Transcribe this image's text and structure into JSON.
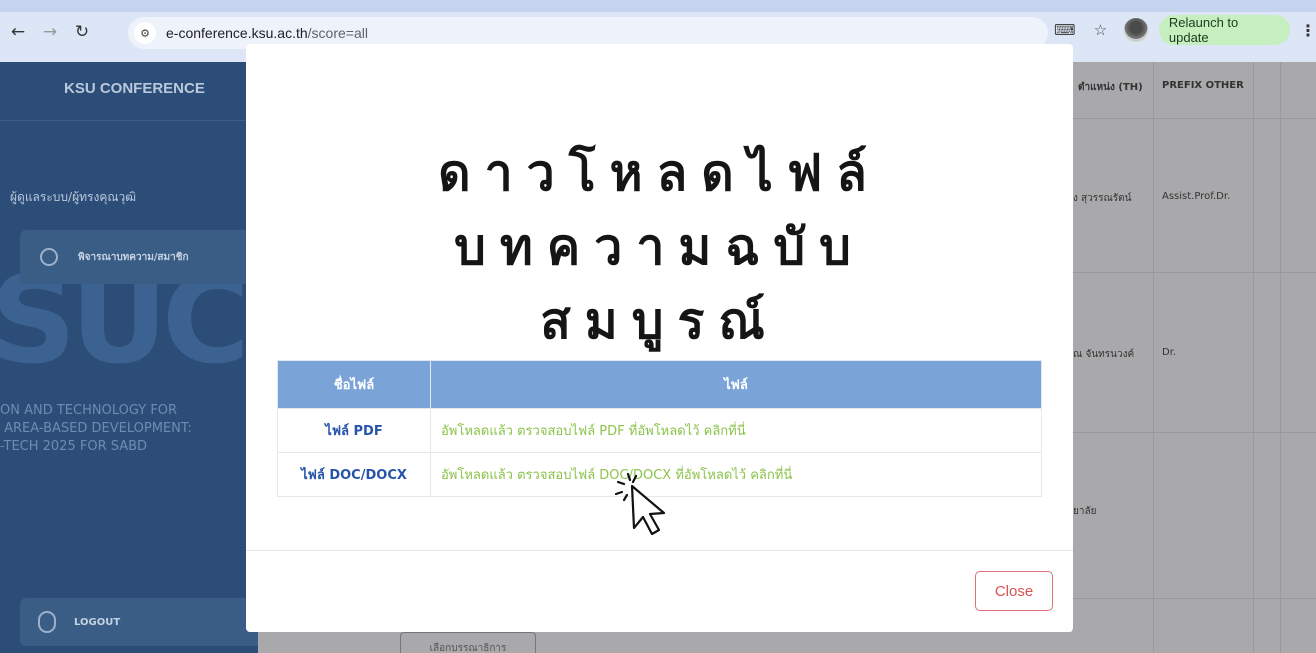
{
  "browser": {
    "url_domain": "e-conference.ksu.ac.th",
    "url_path": "/score=all",
    "relaunch_label": "Relaunch to update"
  },
  "sidebar": {
    "brand": "KSU CONFERENCE",
    "section": "ผู้ดูแลระบบ/ผู้ทรงคุณวุฒิ",
    "item_label": "พิจารณาบทความ/สมาชิก",
    "watermark": "SUC",
    "partial_text": "ON AND TECHNOLOGY FOR\n AREA-BASED DEVELOPMENT:\n-TECH 2025 FOR SABD",
    "logout_label": "LOGOUT"
  },
  "background_table": {
    "header_a": "ตำแหน่ง (TH)",
    "header_b": "PREFIX OTHER",
    "rows": [
      {
        "a": "ง สุวรรณรัตน์",
        "b": "Assist.Prof.Dr."
      },
      {
        "a": "ณ จันทรนวงค์",
        "b": "Dr."
      },
      {
        "a": "ยาลัย",
        "b": ""
      }
    ],
    "bottom_button": "เลือกบรรณาธิการ"
  },
  "modal": {
    "title_lines": [
      "ดาวโหลดไฟล์",
      "บทความฉบับ",
      "สมบูรณ์"
    ],
    "table": {
      "headers": [
        "ชื่อไฟล์",
        "ไฟล์"
      ],
      "rows": [
        {
          "name": "ไฟล์ PDF",
          "status": "อัพโหลดแล้ว ตรวจสอบไฟล์ PDF ที่อัพโหลดไว้ คลิกที่นี่"
        },
        {
          "name": "ไฟล์ DOC/DOCX",
          "status": "อัพโหลดแล้ว ตรวจสอบไฟล์ DOC/DOCX ที่อัพโหลดไว้ คลิกที่นี่"
        }
      ]
    },
    "close_label": "Close"
  },
  "colors": {
    "table_header": "#7aa3d7",
    "file_name": "#2754a8",
    "file_link": "#8bc34a",
    "close_border": "#e0707a",
    "relaunch_bg": "#c6efc0"
  }
}
